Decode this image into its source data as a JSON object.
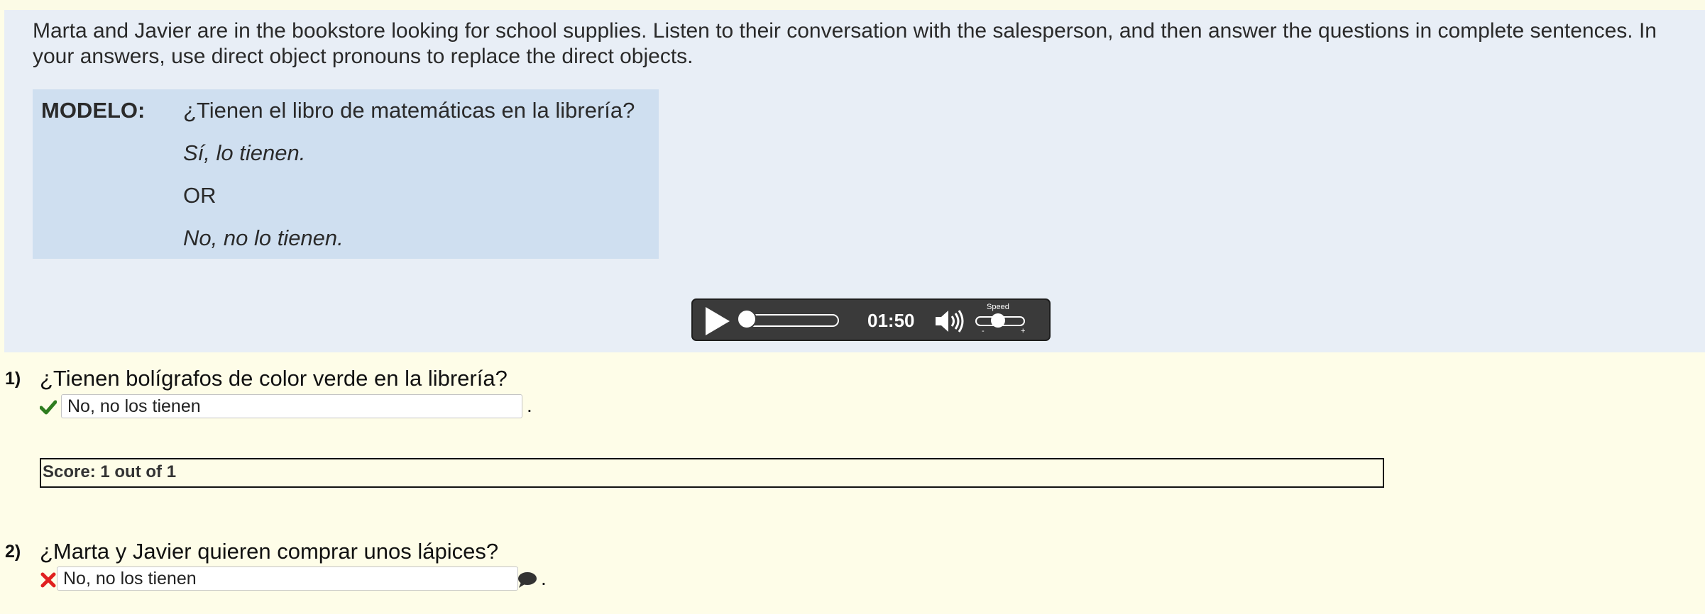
{
  "instructions": {
    "text": "Marta and Javier are in the bookstore looking for school supplies. Listen to their conversation with the salesperson, and then answer the questions in complete sentences. In your answers, use direct object pronouns to replace the direct objects."
  },
  "model": {
    "label": "MODELO:",
    "question": "¿Tienen el libro de matemáticas en la librería?",
    "answer_yes": "Sí, lo tienen.",
    "or": "OR",
    "answer_no": "No, no lo tienen."
  },
  "audio_player": {
    "time": "01:50",
    "speed_label": "Speed",
    "speed_minus": "-",
    "speed_plus": "+",
    "progress": 0
  },
  "questions": [
    {
      "number": "1)",
      "text": "¿Tienen bolígrafos de color verde en la librería?",
      "answer": "No, no los tienen",
      "status": "correct",
      "suffix": "."
    },
    {
      "number": "2)",
      "text": "¿Marta y Javier quieren comprar unos lápices?",
      "answer": "No, no los tienen",
      "status": "incorrect",
      "suffix": "."
    }
  ],
  "score": {
    "label": "Score:",
    "value": "1 out of 1"
  },
  "icons": {
    "check": "check-icon",
    "x": "x-icon",
    "comment": "comment-icon",
    "play": "play-icon",
    "volume": "volume-icon"
  },
  "colors": {
    "page_background": "#fefde8",
    "instructions_background": "#e8eef6",
    "model_background": "#cfdff0",
    "player_background": "#3a3a3a",
    "correct": "#2e7d1f",
    "incorrect": "#e02020"
  }
}
